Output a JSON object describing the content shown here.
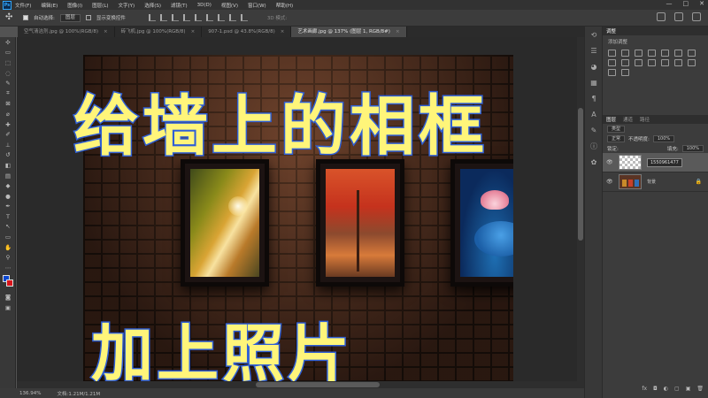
{
  "app": {
    "logo": "Ps",
    "menu": [
      "文件(F)",
      "编辑(E)",
      "图像(I)",
      "图层(L)",
      "文字(Y)",
      "选择(S)",
      "滤镜(T)",
      "3D(D)",
      "视图(V)",
      "窗口(W)",
      "帮助(H)"
    ],
    "window_controls": [
      "—",
      "□",
      "✕"
    ]
  },
  "options": {
    "auto_select_label": "自动选择:",
    "auto_select_value": "图层",
    "transform_label": "显示变换控件",
    "mode_3d": "3D 模式:"
  },
  "tabs": [
    {
      "label": "空气清洁剂.jpg @ 100%(RGB/8)",
      "active": false
    },
    {
      "label": "砖飞机.jpg @ 100%(RGB/8)",
      "active": false
    },
    {
      "label": "907-1.psd @ 43.8%(RGB/8)",
      "active": false
    },
    {
      "label": "艺术画廊.jpg @ 137% (图层 1, RGB/8#)",
      "active": true
    }
  ],
  "canvas": {
    "headline_top": "给墙上的相框",
    "headline_bottom": "加上照片"
  },
  "status": {
    "zoom": "136.94%",
    "doc": "文档:1.21M/1.21M"
  },
  "panels": {
    "adjust_tab": "调整",
    "adjust_title": "添加调整",
    "layer_tabs": [
      "图层",
      "通道",
      "路径"
    ],
    "kind_label": "类型",
    "blend_mode": "正常",
    "opacity_label": "不透明度:",
    "opacity_value": "100%",
    "lock_label": "锁定:",
    "fill_label": "填充:",
    "fill_value": "100%",
    "layers": [
      {
        "name": "1550961477",
        "selected": true
      },
      {
        "name": "背景",
        "selected": false
      }
    ],
    "footer_icons": [
      "fx",
      "◘",
      "◐",
      "▢",
      "▣",
      "🗑"
    ]
  },
  "colors": {
    "foreground": "#0a47d1",
    "background": "#d9141b",
    "headline_fill": "#fff57a",
    "headline_stroke": "#2f5fd6"
  }
}
